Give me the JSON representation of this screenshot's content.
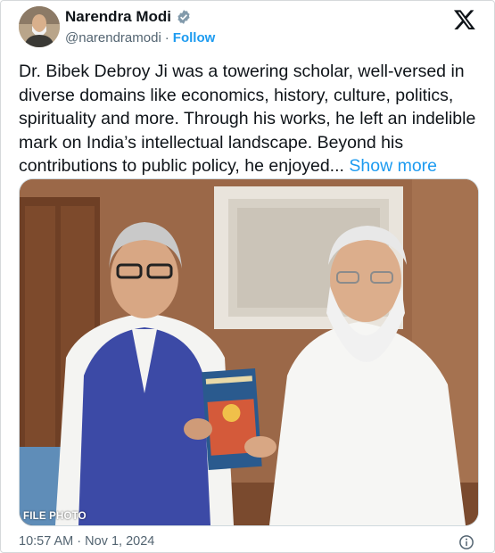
{
  "author": {
    "name": "Narendra Modi",
    "handle": "@narendramodi",
    "separator": "·",
    "follow_label": "Follow",
    "verified_icon": "verified-badge-icon"
  },
  "tweet": {
    "text": "Dr. Bibek Debroy Ji was a towering scholar, well-versed in diverse domains like economics, history, culture, politics, spirituality and more. Through his works, he left an indelible mark on India’s intellectual landscape. Beyond his contributions to public policy, he enjoyed...",
    "show_more_label": "Show more"
  },
  "media": {
    "label": "FILE PHOTO"
  },
  "footer": {
    "timestamp": "10:57 AM · Nov 1, 2024",
    "info_icon": "info-icon"
  },
  "colors": {
    "accent": "#1d9bf0",
    "text": "#0f1419",
    "secondary": "#536471"
  }
}
